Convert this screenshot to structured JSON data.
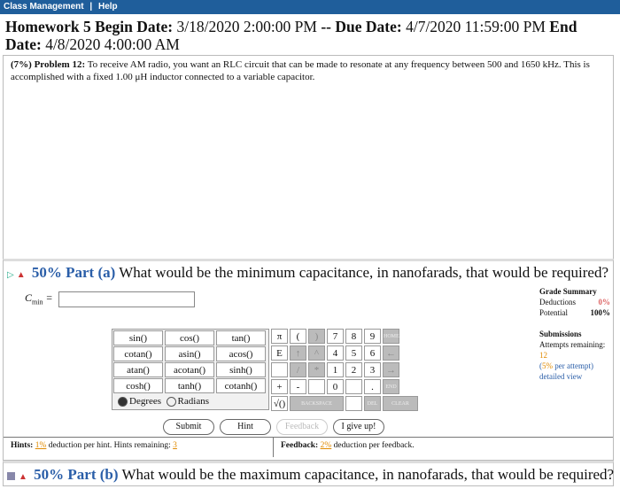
{
  "topbar": {
    "items": [
      "Class Management",
      "|",
      "Help"
    ]
  },
  "homework": {
    "name": "Homework 5",
    "begin_label": "Begin Date:",
    "begin": "3/18/2020 2:00:00 PM",
    "sep": "--",
    "due_label": "Due Date:",
    "due": "4/7/2020 11:59:00 PM",
    "end_label": "End Date:",
    "end": "4/8/2020 4:00:00 AM"
  },
  "problem": {
    "weight": "(7%)",
    "label": "Problem 12:",
    "text": "To receive AM radio, you want an RLC circuit that can be made to resonate at any frequency between 500 and 1650 kHz. This is accomplished with a fixed 1.00 μH inductor connected to a variable capacitor."
  },
  "part_a": {
    "percent": "50%",
    "label": "Part (a)",
    "question": "What would be the minimum capacitance, in nanofarads, that would be required?",
    "var": "C",
    "var_sub": "min",
    "eq": "=",
    "answer_value": ""
  },
  "grade_summary": {
    "title": "Grade Summary",
    "deductions_label": "Deductions",
    "deductions_value": "0%",
    "potential_label": "Potential",
    "potential_value": "100%"
  },
  "submissions": {
    "title": "Submissions",
    "attempts_label": "Attempts remaining:",
    "attempts_value": "12",
    "per_attempt_pct": "5%",
    "per_attempt_label": "per attempt)",
    "detail_link": "detailed view"
  },
  "keypad": {
    "functions": [
      [
        "sin()",
        "cos()",
        "tan()"
      ],
      [
        "cotan()",
        "asin()",
        "acos()"
      ],
      [
        "atan()",
        "acotan()",
        "sinh()"
      ],
      [
        "cosh()",
        "tanh()",
        "cotanh()"
      ]
    ],
    "degrees": "Degrees",
    "radians": "Radians",
    "keys": [
      [
        "π",
        "(",
        ")",
        "7",
        "8",
        "9",
        "HOME"
      ],
      [
        "E",
        "↑",
        "^",
        "4",
        "5",
        "6",
        "←"
      ],
      [
        "",
        "/",
        "*",
        "1",
        "2",
        "3",
        "→"
      ],
      [
        "+",
        "-",
        "",
        "0",
        "",
        ".",
        "END"
      ],
      [
        "√()",
        "BACKSPACE",
        "",
        "DEL",
        "CLEAR"
      ]
    ]
  },
  "buttons": {
    "submit": "Submit",
    "hint": "Hint",
    "feedback": "Feedback",
    "give_up": "I give up!"
  },
  "hints": {
    "label": "Hints:",
    "pct": "1%",
    "text": "deduction per hint. Hints remaining:",
    "remaining": "3"
  },
  "feedback": {
    "label": "Feedback:",
    "pct": "2%",
    "text": "deduction per feedback."
  },
  "part_b": {
    "percent": "50%",
    "label": "Part (b)",
    "question": "What would be the maximum capacitance, in nanofarads, that would be required?"
  }
}
